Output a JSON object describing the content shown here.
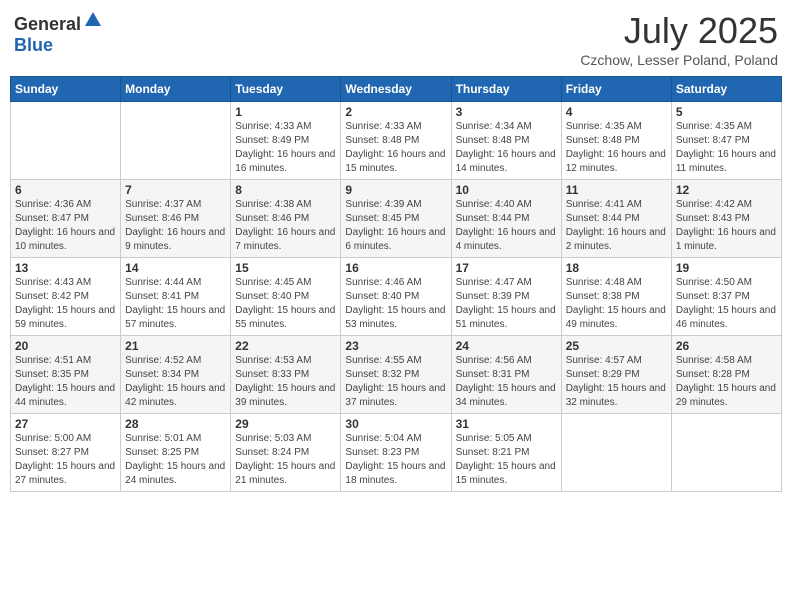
{
  "header": {
    "logo_general": "General",
    "logo_blue": "Blue",
    "month_title": "July 2025",
    "location": "Czchow, Lesser Poland, Poland"
  },
  "weekdays": [
    "Sunday",
    "Monday",
    "Tuesday",
    "Wednesday",
    "Thursday",
    "Friday",
    "Saturday"
  ],
  "weeks": [
    [
      {
        "day": "",
        "info": ""
      },
      {
        "day": "",
        "info": ""
      },
      {
        "day": "1",
        "info": "Sunrise: 4:33 AM\nSunset: 8:49 PM\nDaylight: 16 hours and 16 minutes."
      },
      {
        "day": "2",
        "info": "Sunrise: 4:33 AM\nSunset: 8:48 PM\nDaylight: 16 hours and 15 minutes."
      },
      {
        "day": "3",
        "info": "Sunrise: 4:34 AM\nSunset: 8:48 PM\nDaylight: 16 hours and 14 minutes."
      },
      {
        "day": "4",
        "info": "Sunrise: 4:35 AM\nSunset: 8:48 PM\nDaylight: 16 hours and 12 minutes."
      },
      {
        "day": "5",
        "info": "Sunrise: 4:35 AM\nSunset: 8:47 PM\nDaylight: 16 hours and 11 minutes."
      }
    ],
    [
      {
        "day": "6",
        "info": "Sunrise: 4:36 AM\nSunset: 8:47 PM\nDaylight: 16 hours and 10 minutes."
      },
      {
        "day": "7",
        "info": "Sunrise: 4:37 AM\nSunset: 8:46 PM\nDaylight: 16 hours and 9 minutes."
      },
      {
        "day": "8",
        "info": "Sunrise: 4:38 AM\nSunset: 8:46 PM\nDaylight: 16 hours and 7 minutes."
      },
      {
        "day": "9",
        "info": "Sunrise: 4:39 AM\nSunset: 8:45 PM\nDaylight: 16 hours and 6 minutes."
      },
      {
        "day": "10",
        "info": "Sunrise: 4:40 AM\nSunset: 8:44 PM\nDaylight: 16 hours and 4 minutes."
      },
      {
        "day": "11",
        "info": "Sunrise: 4:41 AM\nSunset: 8:44 PM\nDaylight: 16 hours and 2 minutes."
      },
      {
        "day": "12",
        "info": "Sunrise: 4:42 AM\nSunset: 8:43 PM\nDaylight: 16 hours and 1 minute."
      }
    ],
    [
      {
        "day": "13",
        "info": "Sunrise: 4:43 AM\nSunset: 8:42 PM\nDaylight: 15 hours and 59 minutes."
      },
      {
        "day": "14",
        "info": "Sunrise: 4:44 AM\nSunset: 8:41 PM\nDaylight: 15 hours and 57 minutes."
      },
      {
        "day": "15",
        "info": "Sunrise: 4:45 AM\nSunset: 8:40 PM\nDaylight: 15 hours and 55 minutes."
      },
      {
        "day": "16",
        "info": "Sunrise: 4:46 AM\nSunset: 8:40 PM\nDaylight: 15 hours and 53 minutes."
      },
      {
        "day": "17",
        "info": "Sunrise: 4:47 AM\nSunset: 8:39 PM\nDaylight: 15 hours and 51 minutes."
      },
      {
        "day": "18",
        "info": "Sunrise: 4:48 AM\nSunset: 8:38 PM\nDaylight: 15 hours and 49 minutes."
      },
      {
        "day": "19",
        "info": "Sunrise: 4:50 AM\nSunset: 8:37 PM\nDaylight: 15 hours and 46 minutes."
      }
    ],
    [
      {
        "day": "20",
        "info": "Sunrise: 4:51 AM\nSunset: 8:35 PM\nDaylight: 15 hours and 44 minutes."
      },
      {
        "day": "21",
        "info": "Sunrise: 4:52 AM\nSunset: 8:34 PM\nDaylight: 15 hours and 42 minutes."
      },
      {
        "day": "22",
        "info": "Sunrise: 4:53 AM\nSunset: 8:33 PM\nDaylight: 15 hours and 39 minutes."
      },
      {
        "day": "23",
        "info": "Sunrise: 4:55 AM\nSunset: 8:32 PM\nDaylight: 15 hours and 37 minutes."
      },
      {
        "day": "24",
        "info": "Sunrise: 4:56 AM\nSunset: 8:31 PM\nDaylight: 15 hours and 34 minutes."
      },
      {
        "day": "25",
        "info": "Sunrise: 4:57 AM\nSunset: 8:29 PM\nDaylight: 15 hours and 32 minutes."
      },
      {
        "day": "26",
        "info": "Sunrise: 4:58 AM\nSunset: 8:28 PM\nDaylight: 15 hours and 29 minutes."
      }
    ],
    [
      {
        "day": "27",
        "info": "Sunrise: 5:00 AM\nSunset: 8:27 PM\nDaylight: 15 hours and 27 minutes."
      },
      {
        "day": "28",
        "info": "Sunrise: 5:01 AM\nSunset: 8:25 PM\nDaylight: 15 hours and 24 minutes."
      },
      {
        "day": "29",
        "info": "Sunrise: 5:03 AM\nSunset: 8:24 PM\nDaylight: 15 hours and 21 minutes."
      },
      {
        "day": "30",
        "info": "Sunrise: 5:04 AM\nSunset: 8:23 PM\nDaylight: 15 hours and 18 minutes."
      },
      {
        "day": "31",
        "info": "Sunrise: 5:05 AM\nSunset: 8:21 PM\nDaylight: 15 hours and 15 minutes."
      },
      {
        "day": "",
        "info": ""
      },
      {
        "day": "",
        "info": ""
      }
    ]
  ]
}
